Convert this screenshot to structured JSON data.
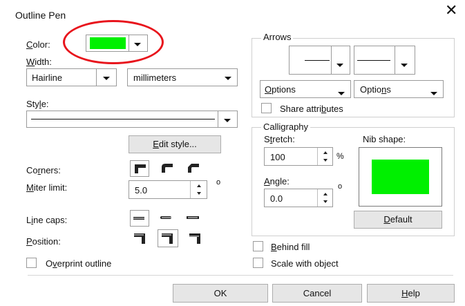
{
  "window": {
    "title": "Outline Pen",
    "close_glyph": "✕"
  },
  "color": {
    "label": "Color:",
    "swatch": "#00f000"
  },
  "width": {
    "label": "Width:",
    "value": "Hairline",
    "unit": "millimeters"
  },
  "style": {
    "label": "Style:"
  },
  "edit_style_label": "Edit style...",
  "corners": {
    "label": "Corners:"
  },
  "miter": {
    "label": "Miter limit:",
    "value": "5.0",
    "unit": "o"
  },
  "line_caps": {
    "label": "Line caps:"
  },
  "position": {
    "label": "Position:"
  },
  "overprint_label": "Overprint outline",
  "arrows": {
    "title": "Arrows",
    "options1": "Options",
    "options2": "Options",
    "share_label": "Share attributes"
  },
  "calligraphy": {
    "title": "Calligraphy",
    "stretch_label": "Stretch:",
    "stretch_value": "100",
    "stretch_unit": "%",
    "angle_label": "Angle:",
    "angle_value": "0.0",
    "angle_unit": "o",
    "nib_label": "Nib shape:",
    "nib_color": "#00f000",
    "default_label": "Default"
  },
  "behind_fill_label": "Behind fill",
  "scale_label": "Scale with object",
  "buttons": {
    "ok": "OK",
    "cancel": "Cancel",
    "help": "Help"
  },
  "annotation": {
    "color": "#e8141c"
  }
}
